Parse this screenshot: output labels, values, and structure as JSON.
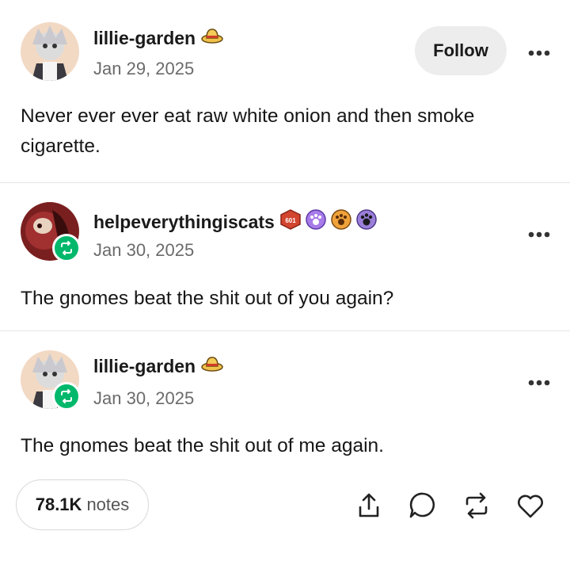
{
  "posts": [
    {
      "username": "lillie-garden",
      "date": "Jan 29, 2025",
      "text": "Never ever ever eat raw white onion and then smoke cigarette.",
      "follow_label": "Follow"
    },
    {
      "username": "helpeverythingiscats",
      "date": "Jan 30, 2025",
      "text": "The gnomes beat the shit out of you again?"
    },
    {
      "username": "lillie-garden",
      "date": "Jan 30, 2025",
      "text": "The gnomes beat the shit out of me again."
    }
  ],
  "footer": {
    "notes_count": "78.1K",
    "notes_label": "notes"
  },
  "colors": {
    "reblog_green": "#00b86b",
    "follow_bg": "#ededed"
  },
  "icons": [
    "straw-hat-icon",
    "red-hexagon-badge-icon",
    "paw-badge-icon",
    "share-icon",
    "reply-icon",
    "reblog-icon",
    "heart-icon",
    "more-options-icon"
  ]
}
